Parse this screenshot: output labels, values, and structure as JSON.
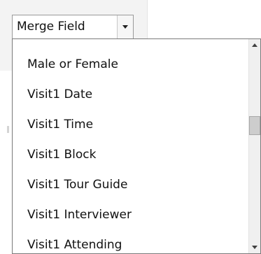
{
  "merge_field_combo": {
    "label": "Merge Field",
    "dropdown_icon": "chevron-down-icon"
  },
  "dropdown_list": {
    "items": [
      {
        "label": "Male or Female"
      },
      {
        "label": "Visit1 Date"
      },
      {
        "label": "Visit1 Time"
      },
      {
        "label": "Visit1 Block"
      },
      {
        "label": "Visit1 Tour Guide"
      },
      {
        "label": "Visit1 Interviewer"
      },
      {
        "label": "Visit1 Attending"
      }
    ]
  },
  "scrollbar": {
    "up_icon": "arrow-up-icon",
    "down_icon": "arrow-down-icon",
    "scroll_position": 0.35
  },
  "colors": {
    "ribbon_background": "#f3f3f3",
    "list_background": "#ffffff",
    "text": "#111111",
    "border": "#7a7a7a"
  }
}
